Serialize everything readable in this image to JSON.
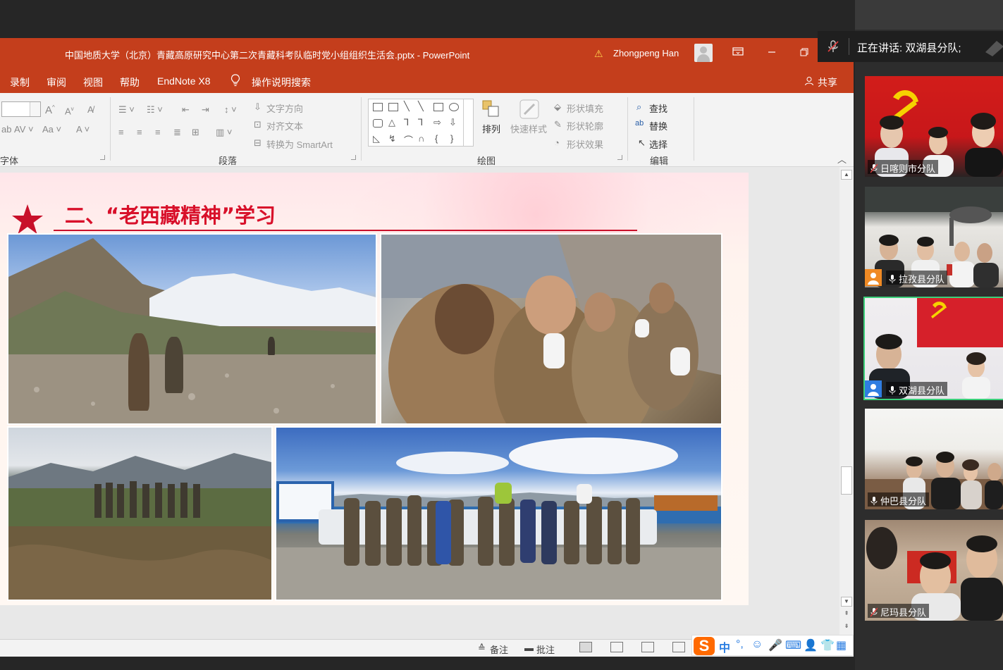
{
  "window": {
    "title": "中国地质大学（北京）青藏高原研究中心第二次青藏科考队临时党小组组织生活会.pptx  -  PowerPoint",
    "user": "Zhongpeng Han"
  },
  "tabs": [
    "录制",
    "审阅",
    "视图",
    "帮助",
    "EndNote X8"
  ],
  "tell_me": "操作说明搜索",
  "share": "共享",
  "ribbon": {
    "groups": {
      "font": "字体",
      "paragraph": "段落",
      "drawing": "绘图",
      "editing": "编辑"
    },
    "paragraph_cmds": {
      "text_direction": "文字方向",
      "align_text": "对齐文本",
      "convert_smartart": "转换为 SmartArt"
    },
    "drawing_cmds": {
      "arrange": "排列",
      "quick_styles": "快速样式",
      "shape_fill": "形状填充",
      "shape_outline": "形状轮廓",
      "shape_effects": "形状效果"
    },
    "editing_cmds": {
      "find": "查找",
      "replace": "替换",
      "select": "选择"
    }
  },
  "slide": {
    "title": "二、“老西藏精神”学习",
    "colors": {
      "title": "#d8102a",
      "accent": "#c43e1c"
    }
  },
  "statusbar": {
    "notes": "备注",
    "comments": "批注"
  },
  "ime": {
    "mode": "中"
  },
  "meeting": {
    "speaking": "正在讲话: 双湖县分队;",
    "participants": [
      {
        "name": "日喀则市分队",
        "muted": true
      },
      {
        "name": "拉孜县分队",
        "muted": false
      },
      {
        "name": "双湖县分队",
        "muted": false,
        "active": true
      },
      {
        "name": "仲巴县分队",
        "muted": false
      },
      {
        "name": "尼玛县分队",
        "muted": true
      }
    ]
  }
}
